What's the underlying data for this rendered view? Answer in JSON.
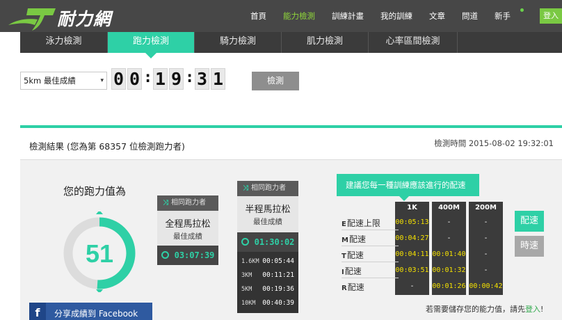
{
  "header": {
    "logo_text": "耐力網",
    "nav": [
      "首頁",
      "能力檢測",
      "訓練計畫",
      "我的訓練",
      "文章",
      "問道",
      "新手"
    ],
    "active_nav": 1,
    "login_label": "登入",
    "accent": "#2ed0a6",
    "brand_green": "#8fd63a"
  },
  "subtabs": {
    "items": [
      "泳力檢測",
      "跑力檢測",
      "騎力檢測",
      "肌力檢測",
      "心率區間檢測"
    ],
    "active": 1
  },
  "controls": {
    "distance_select": "5km 最佳成績",
    "time_digits": [
      "0",
      "0",
      "1",
      "9",
      "3",
      "1"
    ],
    "test_button": "檢測"
  },
  "result": {
    "title": "檢測結果 (您為第 68357 位檢測跑力者)",
    "test_time": "檢測時間 2015-08-02 19:32:01",
    "score_title": "您的跑力值為",
    "score_value": "51",
    "score_fraction": 0.51,
    "share_label": "分享成績到 Facebook",
    "share_icon": "f",
    "full_marathon": {
      "head": "相同跑力者",
      "line1": "全程馬拉松",
      "line2": "最佳成績",
      "time": "03:07:39"
    },
    "half_marathon": {
      "head": "相同跑力者",
      "line1": "半程馬拉松",
      "line2": "最佳成績",
      "time": "01:30:02",
      "splits": [
        {
          "k": "1.6KM",
          "v": "00:05:44"
        },
        {
          "k": "3KM",
          "v": "00:11:21"
        },
        {
          "k": "5KM",
          "v": "00:19:36"
        },
        {
          "k": "10KM",
          "v": "00:40:39"
        }
      ]
    }
  },
  "pace": {
    "advise": "建議您每一種訓練應該進行的配速",
    "columns": [
      "1K",
      "400M",
      "200M"
    ],
    "rows": [
      {
        "code": "E",
        "label": "配速上限",
        "values": [
          "00:05:13",
          "-",
          "-"
        ]
      },
      {
        "code": "M",
        "label": "配速",
        "values": [
          "00:04:27",
          "-",
          "-"
        ]
      },
      {
        "code": "T",
        "label": "配速",
        "values": [
          "00:04:11",
          "00:01:40",
          "-"
        ]
      },
      {
        "code": "I",
        "label": "配速",
        "values": [
          "00:03:51",
          "00:01:32",
          "-"
        ]
      },
      {
        "code": "R",
        "label": "配速",
        "values": [
          "-",
          "00:01:26",
          "00:00:42"
        ]
      }
    ],
    "unit_pace": "配速",
    "unit_speed": "時速",
    "save_note": "若需要儲存您的能力值，請先",
    "save_link": "登入",
    "save_end": "!"
  }
}
